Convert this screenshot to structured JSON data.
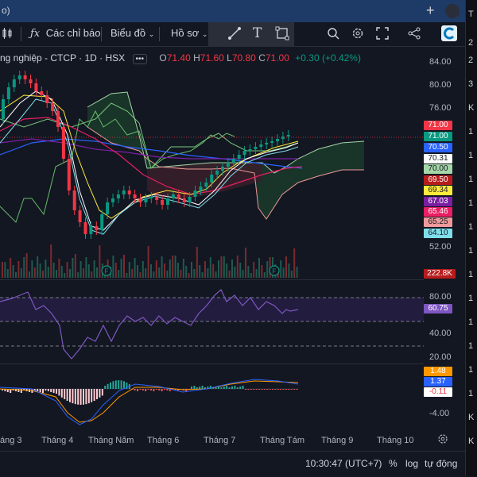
{
  "window": {
    "tab_title": "o)",
    "plus_label": "+"
  },
  "toolbar": {
    "indicators_label": "Các chỉ báo",
    "chart_type_label": "Biểu đồ",
    "profile_label": "Hồ sơ",
    "fx_icon": "fx-icon"
  },
  "legend": {
    "symbol": "ng nghiệp - CTCP · 1D · HSX",
    "more": "•••",
    "open_key": "O",
    "open": "71.40",
    "high_key": "H",
    "high": "71.60",
    "low_key": "L",
    "low": "70.80",
    "close_key": "C",
    "close": "71.00",
    "change": "+0.30 (+0.42%)"
  },
  "price_axis": [
    "84.00",
    "80.00",
    "76.00",
    "52.00"
  ],
  "price_tags": [
    {
      "value": "71.00",
      "bg": "#f23645",
      "fg": "#ffffff"
    },
    {
      "value": "71.00",
      "bg": "#089981",
      "fg": "#ffffff"
    },
    {
      "value": "70.50",
      "bg": "#2962ff",
      "fg": "#ffffff"
    },
    {
      "value": "70.31",
      "bg": "#ffffff",
      "fg": "#131722"
    },
    {
      "value": "70.00",
      "bg": "#a5d6a7",
      "fg": "#131722"
    },
    {
      "value": "69.50",
      "bg": "#b71c1c",
      "fg": "#ffffff"
    },
    {
      "value": "69.34",
      "bg": "#ffeb3b",
      "fg": "#131722"
    },
    {
      "value": "67.03",
      "bg": "#7b1fa2",
      "fg": "#ffffff"
    },
    {
      "value": "65.46",
      "bg": "#e91e63",
      "fg": "#ffffff"
    },
    {
      "value": "65.25",
      "bg": "#ef9a9a",
      "fg": "#131722"
    },
    {
      "value": "64.10",
      "bg": "#80deea",
      "fg": "#131722"
    }
  ],
  "volume_tag": {
    "value": "222.8K",
    "bg": "#b71c1c",
    "fg": "#ffffff"
  },
  "rsi": {
    "axis": [
      "80.00",
      "40.00",
      "20.00"
    ],
    "value": "60.75",
    "bg": "#7e57c2"
  },
  "macd": {
    "axis": [
      "-4.00"
    ],
    "tags": [
      {
        "value": "1.48",
        "bg": "#ff9800",
        "fg": "#ffffff"
      },
      {
        "value": "1.37",
        "bg": "#2962ff",
        "fg": "#ffffff"
      },
      {
        "value": "-0.11",
        "bg": "#ffffff",
        "fg": "#f23645"
      }
    ]
  },
  "time_axis": [
    "áng 3",
    "Tháng 4",
    "Tháng Năm",
    "Tháng 6",
    "Tháng 7",
    "Tháng Tám",
    "Tháng 9",
    "Tháng 10"
  ],
  "bottom": {
    "time": "10:30:47 (UTC+7)",
    "percent": "%",
    "log": "log",
    "auto": "tự động"
  },
  "right_panel": [
    "T",
    "2",
    "2",
    "3",
    "K",
    "1",
    "1",
    "1",
    "1",
    "1",
    "1",
    "1",
    "1",
    "1",
    "1",
    "1",
    "1",
    "K",
    "K"
  ],
  "colors": {
    "up": "#089981",
    "down": "#f23645",
    "bg": "#131722",
    "accent": "#2962ff"
  }
}
